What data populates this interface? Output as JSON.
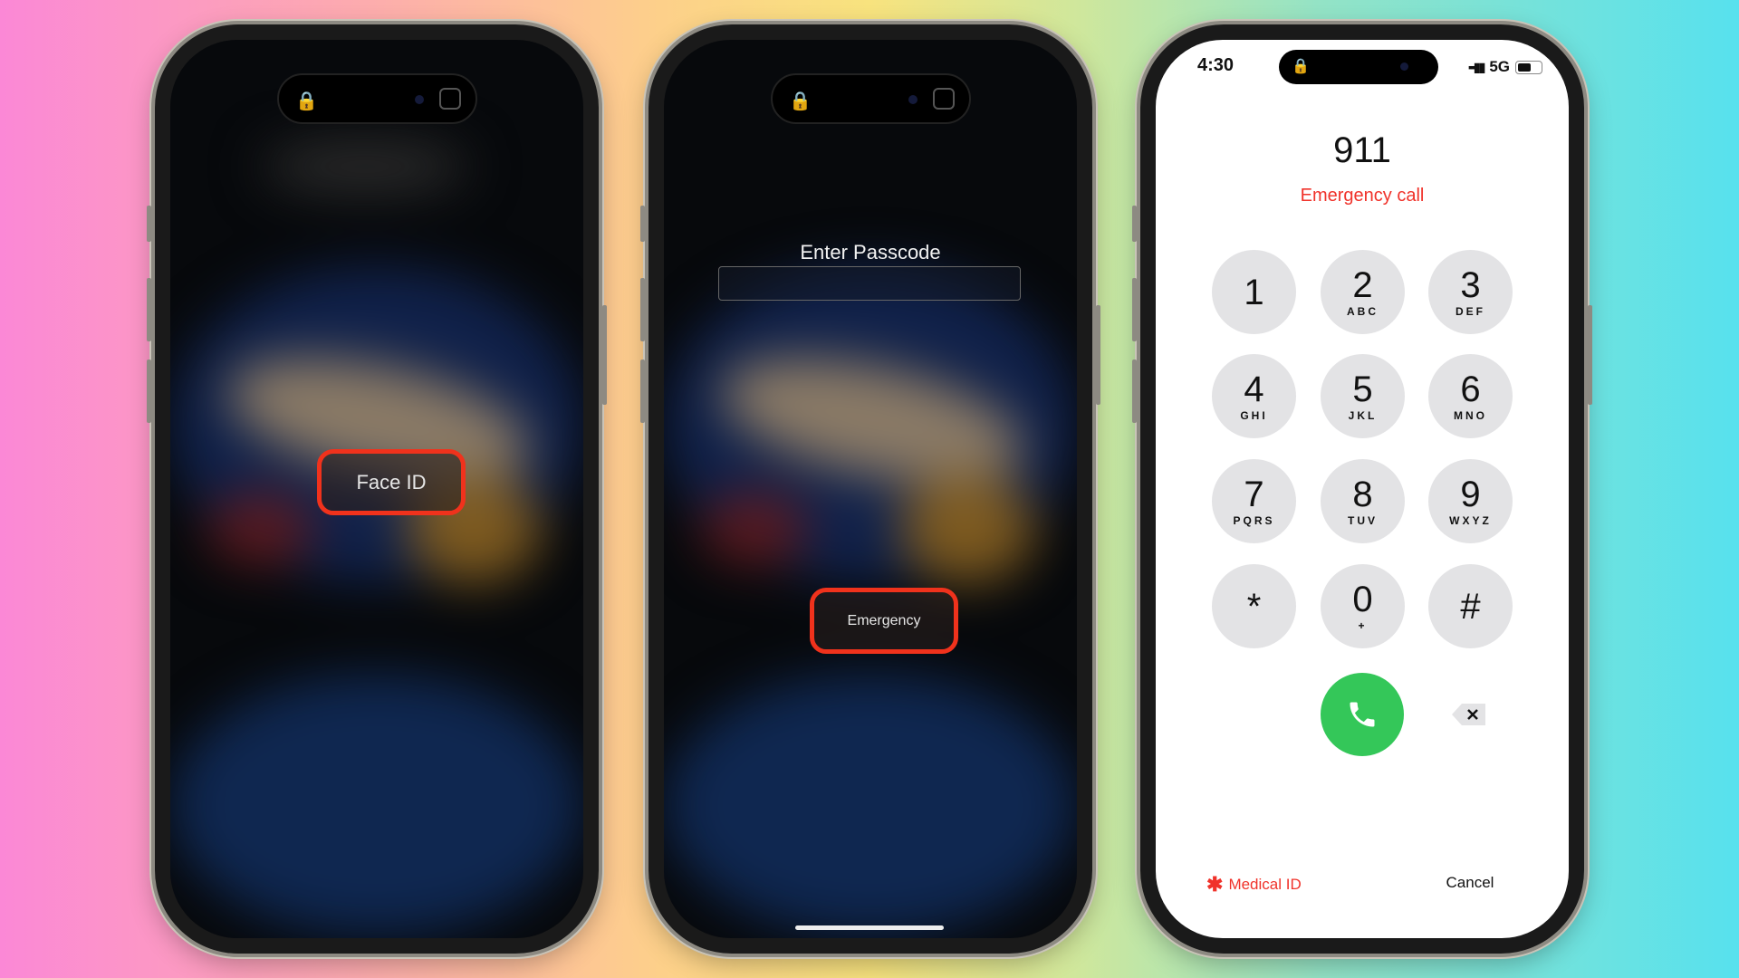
{
  "phone1": {
    "face_id_label": "Face ID"
  },
  "phone2": {
    "title": "Enter Passcode",
    "passcode_value": "",
    "emergency_label": "Emergency"
  },
  "phone3": {
    "status": {
      "time": "4:30",
      "network": "5G",
      "battery_level": 0.6
    },
    "number": "911",
    "subtitle": "Emergency call",
    "keys": [
      {
        "d": "1",
        "l": ""
      },
      {
        "d": "2",
        "l": "ABC"
      },
      {
        "d": "3",
        "l": "DEF"
      },
      {
        "d": "4",
        "l": "GHI"
      },
      {
        "d": "5",
        "l": "JKL"
      },
      {
        "d": "6",
        "l": "MNO"
      },
      {
        "d": "7",
        "l": "PQRS"
      },
      {
        "d": "8",
        "l": "TUV"
      },
      {
        "d": "9",
        "l": "WXYZ"
      },
      {
        "d": "*",
        "l": ""
      },
      {
        "d": "0",
        "l": "+"
      },
      {
        "d": "#",
        "l": ""
      }
    ],
    "medical_id": "Medical ID",
    "cancel": "Cancel",
    "colors": {
      "red": "#f0322a",
      "call_green": "#34c759",
      "key_bg": "#e3e3e5"
    }
  }
}
